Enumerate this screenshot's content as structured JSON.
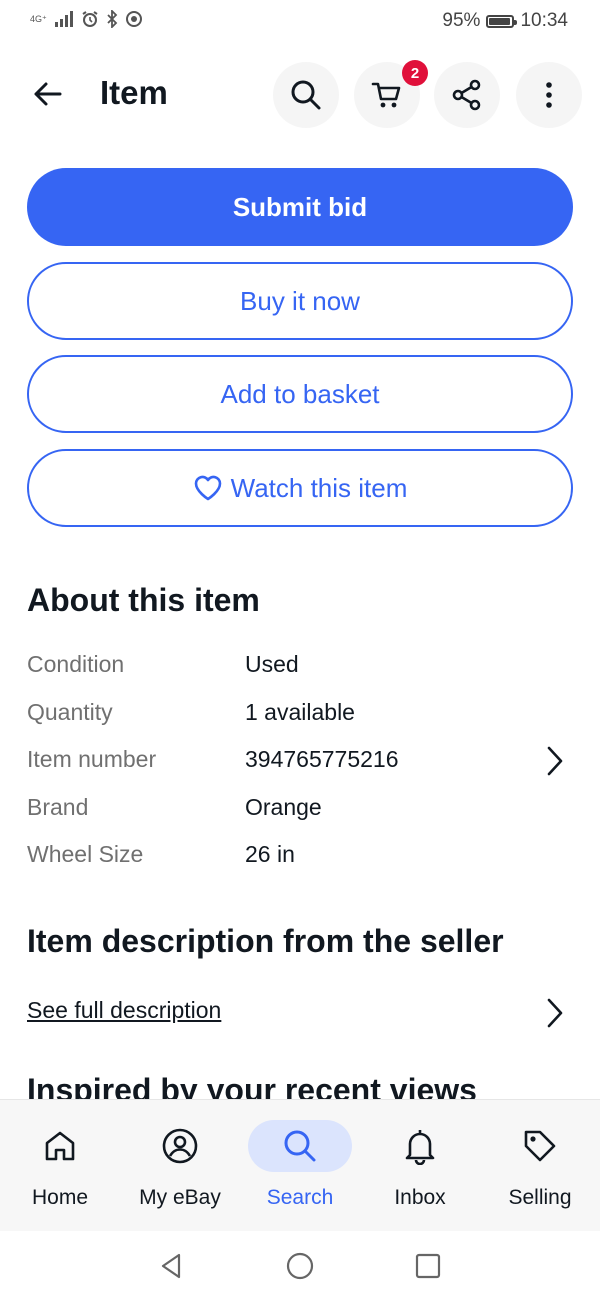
{
  "status_bar": {
    "network": "4G⁺",
    "battery_percent": "95%",
    "battery_level": 0.95,
    "time": "10:34"
  },
  "header": {
    "title": "Item",
    "cart_count": "2",
    "icons": [
      "back-arrow-icon",
      "search-icon",
      "cart-icon",
      "share-icon",
      "more-vertical-icon"
    ]
  },
  "actions": {
    "submit_bid": "Submit bid",
    "buy_now": "Buy it now",
    "add_basket": "Add to basket",
    "watch": "Watch this item"
  },
  "about": {
    "heading": "About this item",
    "rows": [
      {
        "key": "Condition",
        "value": "Used"
      },
      {
        "key": "Quantity",
        "value": "1 available"
      },
      {
        "key": "Item number",
        "value": "394765775216"
      },
      {
        "key": "Brand",
        "value": "Orange"
      },
      {
        "key": "Wheel Size",
        "value": "26 in"
      }
    ]
  },
  "description": {
    "heading": "Item description from the seller",
    "link": "See full description"
  },
  "next_section": {
    "heading": "Inspired by your recent views"
  },
  "bottom_nav": {
    "items": [
      {
        "label": "Home",
        "icon": "home-icon"
      },
      {
        "label": "My eBay",
        "icon": "user-icon"
      },
      {
        "label": "Search",
        "icon": "search-icon"
      },
      {
        "label": "Inbox",
        "icon": "bell-icon"
      },
      {
        "label": "Selling",
        "icon": "tag-icon"
      }
    ],
    "active": "Search"
  },
  "colors": {
    "accent": "#3665f3",
    "badge": "#e0103a",
    "active_pill": "#dbe4fd"
  }
}
